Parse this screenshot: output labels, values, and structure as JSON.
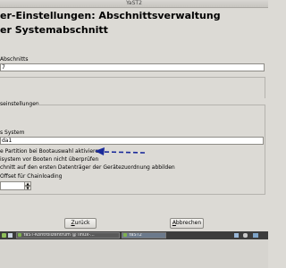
{
  "window": {
    "title": "YaST2"
  },
  "header": {
    "title_line1": "er-Einstellungen: Abschnittsverwaltung",
    "title_line2": "er Systemabschnitt"
  },
  "section": {
    "label": "Abschnitts",
    "value": "7"
  },
  "settings_group": {
    "label": "seinstellungen"
  },
  "system": {
    "label": "s System",
    "value": "da1"
  },
  "options": {
    "activate_partition": "e Partition bei Bootauswahl aktivieren",
    "skip_check": "isystem vor Booten nicht überprüfen",
    "remap": "chnitt auf den ersten Datenträger der Gerätezuordnung abbilden",
    "offset_label": "Offset für Chainloading",
    "offset_value": ""
  },
  "buttons": {
    "back": "Zurück",
    "back_accel": "Z",
    "back_rest": "urück",
    "cancel": "Abbrechen",
    "cancel_accel": "A",
    "cancel_rest": "bbrechen"
  },
  "taskbar": {
    "items": [
      {
        "label": "YaST-Kontrollzentrum @ linux-..."
      },
      {
        "label": "YaST2"
      }
    ],
    "tray_icons": [
      "network-icon",
      "volume-icon",
      "monitor-icon"
    ]
  },
  "colors": {
    "arrow": "#1a2a9a",
    "background": "#dcdad5",
    "taskbar": "#3c3c3c"
  }
}
